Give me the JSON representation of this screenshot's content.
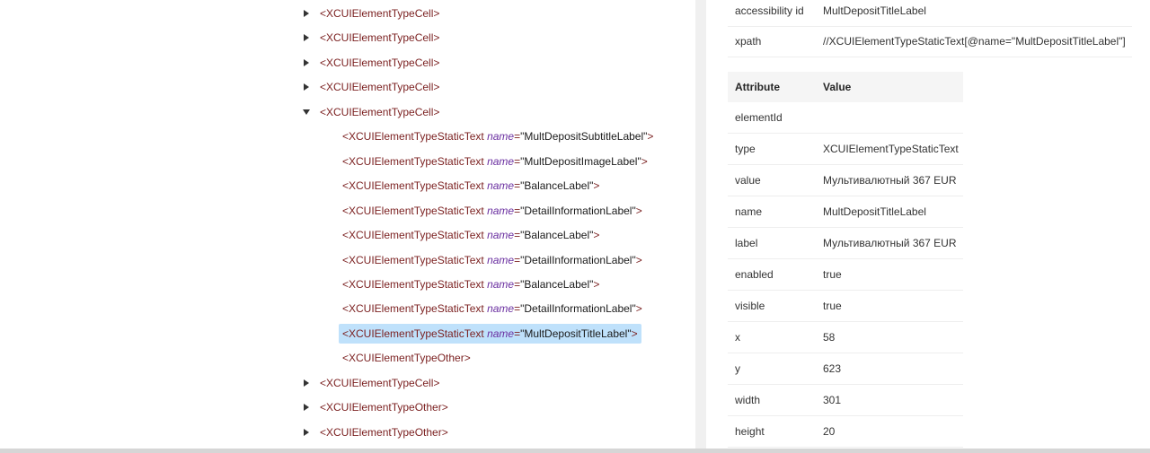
{
  "tree": {
    "nodes": [
      {
        "tag": "<XCUIElementTypeCell>",
        "expanded": false
      },
      {
        "tag": "<XCUIElementTypeCell>",
        "expanded": false
      },
      {
        "tag": "<XCUIElementTypeCell>",
        "expanded": false
      },
      {
        "tag": "<XCUIElementTypeCell>",
        "expanded": false
      },
      {
        "tag": "<XCUIElementTypeCell>",
        "expanded": true
      },
      {
        "tag": "<XCUIElementTypeStaticText",
        "attr": "name",
        "value": "\"MultDepositSubtitleLabel\"",
        "close": ">"
      },
      {
        "tag": "<XCUIElementTypeStaticText",
        "attr": "name",
        "value": "\"MultDepositImageLabel\"",
        "close": ">"
      },
      {
        "tag": "<XCUIElementTypeStaticText",
        "attr": "name",
        "value": "\"BalanceLabel\"",
        "close": ">"
      },
      {
        "tag": "<XCUIElementTypeStaticText",
        "attr": "name",
        "value": "\"DetailInformationLabel\"",
        "close": ">"
      },
      {
        "tag": "<XCUIElementTypeStaticText",
        "attr": "name",
        "value": "\"BalanceLabel\"",
        "close": ">"
      },
      {
        "tag": "<XCUIElementTypeStaticText",
        "attr": "name",
        "value": "\"DetailInformationLabel\"",
        "close": ">"
      },
      {
        "tag": "<XCUIElementTypeStaticText",
        "attr": "name",
        "value": "\"BalanceLabel\"",
        "close": ">"
      },
      {
        "tag": "<XCUIElementTypeStaticText",
        "attr": "name",
        "value": "\"DetailInformationLabel\"",
        "close": ">"
      },
      {
        "tag": "<XCUIElementTypeStaticText",
        "attr": "name",
        "value": "\"MultDepositTitleLabel\"",
        "close": ">",
        "selected": true
      },
      {
        "tag": "<XCUIElementTypeOther>"
      },
      {
        "tag": "<XCUIElementTypeCell>",
        "expanded": false
      },
      {
        "tag": "<XCUIElementTypeOther>",
        "expanded": false
      },
      {
        "tag": "<XCUIElementTypeOther>",
        "expanded": false
      }
    ]
  },
  "selectors": [
    {
      "key": "accessibility id",
      "value": "MultDepositTitleLabel"
    },
    {
      "key": "xpath",
      "value": "//XCUIElementTypeStaticText[@name=\"MultDepositTitleLabel\"]"
    }
  ],
  "attributes": {
    "header": {
      "attribute": "Attribute",
      "value": "Value"
    },
    "rows": [
      {
        "key": "elementId",
        "value": ""
      },
      {
        "key": "type",
        "value": "XCUIElementTypeStaticText"
      },
      {
        "key": "value",
        "value": "Мультивалютный 367 EUR"
      },
      {
        "key": "name",
        "value": "MultDepositTitleLabel"
      },
      {
        "key": "label",
        "value": "Мультивалютный 367 EUR"
      },
      {
        "key": "enabled",
        "value": "true"
      },
      {
        "key": "visible",
        "value": "true"
      },
      {
        "key": "x",
        "value": "58"
      },
      {
        "key": "y",
        "value": "623"
      },
      {
        "key": "width",
        "value": "301"
      },
      {
        "key": "height",
        "value": "20"
      }
    ]
  },
  "colors": {
    "tag": "#7a1f1f",
    "attr_name": "#6a2fa0",
    "selection": "#bfe1fb"
  },
  "icons": {
    "collapsed": "caret-right-icon",
    "expanded": "caret-down-icon"
  }
}
